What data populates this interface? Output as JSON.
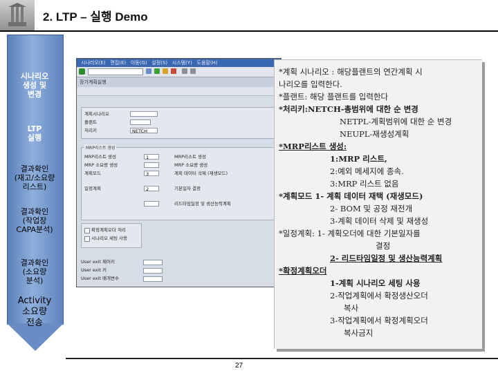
{
  "header": {
    "title": "2. LTP – 실행 Demo"
  },
  "left_steps": [
    {
      "lines": [
        "시나리오",
        "생성 및",
        "변경"
      ]
    },
    {
      "lines": [
        "LTP",
        "실행"
      ]
    },
    {
      "lines": [
        "결과확인",
        "(재고/소요량",
        "리스트)"
      ]
    },
    {
      "lines": [
        "결과확인",
        "(작업장",
        "CAPA분석)"
      ]
    },
    {
      "lines": [
        "결과확인",
        "(소요량",
        "분석)"
      ]
    },
    {
      "lines": [
        "Activity",
        "소요량",
        "전송"
      ]
    }
  ],
  "sap": {
    "menu": [
      "시나리오(E)",
      "편집(E)",
      "이동(G)",
      "설정(S)",
      "시스템(Y)",
      "도움말(H)"
    ],
    "title": "장기계획실행",
    "fields": [
      {
        "label": "계획시나리오",
        "value": ""
      },
      {
        "label": "플랜트",
        "value": ""
      },
      {
        "label": "처리키",
        "value": "NETCH"
      },
      {
        "label": "MRP리스트 생성",
        "value": "1"
      },
      {
        "label": "계획모드",
        "value": "3"
      },
      {
        "label": "일정계획",
        "value": "2"
      }
    ],
    "right_labels": [
      "MRP리스트 생성",
      "MRP 소요량 생성",
      "계획 데이터 삭제 (재생모드)",
      "기본일자 결정",
      "리드타임일정 및 생산능력계획"
    ],
    "options": [
      "확정계획오더 처리",
      "시나리오 세팅 사용"
    ],
    "user_exits": [
      "User exit 제어키",
      "User exit 키",
      "User exit 매개변수"
    ]
  },
  "notes": [
    {
      "text": "*계획 시나리오 : 해당플랜트의 연간계획 시",
      "style": "first"
    },
    {
      "text": "나리오를 입력한다.",
      "style": "plain"
    },
    {
      "text": "*플랜트: 해당 플랜트를 입력한다",
      "style": "plant"
    },
    {
      "text": "*처리키:NETCH-총범위에 대한 순 변경",
      "style": "proc"
    },
    {
      "text": "NETPL-계획범위에 대한 순 변경",
      "style": "indent"
    },
    {
      "text": "NEUPL-재생성계획",
      "style": "indent"
    },
    {
      "text": "*MRP리스트 생성:",
      "style": "mrp"
    },
    {
      "text": "1:MRP 리스트,",
      "style": "indent2b"
    },
    {
      "text": "2:예외 메세지에 종속.",
      "style": "indent2"
    },
    {
      "text": "3:MRP 리스트 없음",
      "style": "indent2"
    },
    {
      "text": "*계획모드 1- 계획 데이터 재택 (재생모드)",
      "style": "mode"
    },
    {
      "text": "2- BOM 및 공정 재전개",
      "style": "indent2"
    },
    {
      "text": "3-계획 데이터 삭제 및 재생성",
      "style": "indent2"
    },
    {
      "text": "*일정계획: 1- 계획오더에 대한 기본일자를",
      "style": "sched"
    },
    {
      "text": "결정",
      "style": "indent3"
    },
    {
      "text": "2- 리드타임일정 및 생산능력계획",
      "style": "indent2bu"
    },
    {
      "text": "*확정계획오더",
      "style": "firm"
    },
    {
      "text": "1-계획 시나리오 세팅 사용",
      "style": "indent2b"
    },
    {
      "text": "2-작업계획에서 확정생산오더",
      "style": "indent2"
    },
    {
      "text": "복사",
      "style": "indent3"
    },
    {
      "text": "3-작업계획에서 확정계획오더",
      "style": "indent2"
    },
    {
      "text": "복사금지",
      "style": "indent3"
    }
  ],
  "footer": {
    "page": "27"
  }
}
